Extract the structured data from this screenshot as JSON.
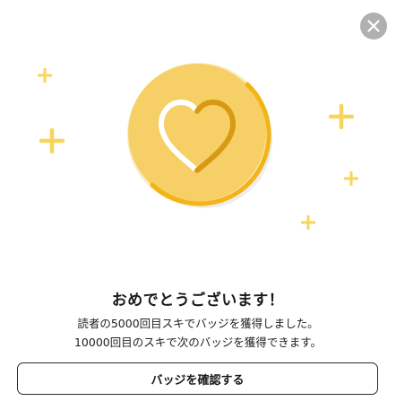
{
  "dialog": {
    "close_icon": "close-icon",
    "title": "おめでとうございます！",
    "message_line1": "読者の5000回目スキでバッジを獲得しました。",
    "message_line2": "10000回目のスキで次のバッジを獲得できます。",
    "confirm_button_label": "バッジを確認する"
  },
  "badge": {
    "icon": "heart-icon",
    "coin_color": "#F6D066",
    "ring_color": "#F2B417",
    "heart_stroke_light": "#FFFFFF",
    "heart_stroke_dark": "#D89A12",
    "sparkle_color": "#F8D55A"
  }
}
